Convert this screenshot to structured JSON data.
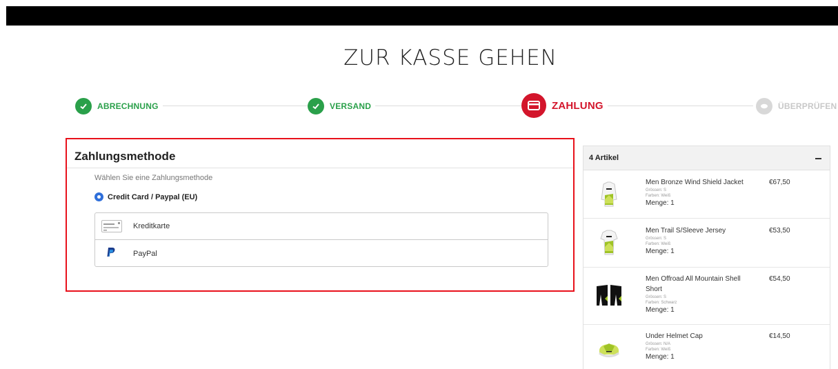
{
  "page": {
    "title": "ZUR KASSE GEHEN"
  },
  "steps": [
    {
      "label": "ABRECHNUNG",
      "state": "done"
    },
    {
      "label": "VERSAND",
      "state": "done"
    },
    {
      "label": "ZAHLUNG",
      "state": "active"
    },
    {
      "label": "ÜBERPRÜFEN",
      "state": "todo"
    }
  ],
  "colors": {
    "done": "#2aa04a",
    "active": "#d3152b",
    "todo": "#d8d8d8",
    "highlight_border": "#e8101a",
    "radio": "#2f6fda"
  },
  "payment": {
    "title": "Zahlungsmethode",
    "hint": "Wählen Sie eine Zahlungsmethode",
    "selected_option": "Credit Card / Paypal (EU)",
    "methods": [
      {
        "label": "Kreditkarte",
        "icon": "credit-card-icon"
      },
      {
        "label": "PayPal",
        "icon": "paypal-icon"
      }
    ]
  },
  "cart": {
    "count_label": "4 Artikel",
    "items": [
      {
        "name": "Men Bronze Wind Shield Jacket",
        "price": "€67,50",
        "size": "Grössen: S",
        "color": "Farben: Weiß",
        "qty": "Menge: 1",
        "icon": "jacket-icon"
      },
      {
        "name": "Men Trail S/Sleeve Jersey",
        "price": "€53,50",
        "size": "Grössen: S",
        "color": "Farben: Weiß",
        "qty": "Menge: 1",
        "icon": "jersey-icon"
      },
      {
        "name": "Men Offroad All Mountain Shell Short",
        "price": "€54,50",
        "size": "Grössen: S",
        "color": "Farben: Schwarz",
        "qty": "Menge: 1",
        "icon": "shorts-icon"
      },
      {
        "name": "Under Helmet Cap",
        "price": "€14,50",
        "size": "Grössen: N/A",
        "color": "Farben: Weiß",
        "qty": "Menge: 1",
        "icon": "cap-icon"
      }
    ]
  }
}
